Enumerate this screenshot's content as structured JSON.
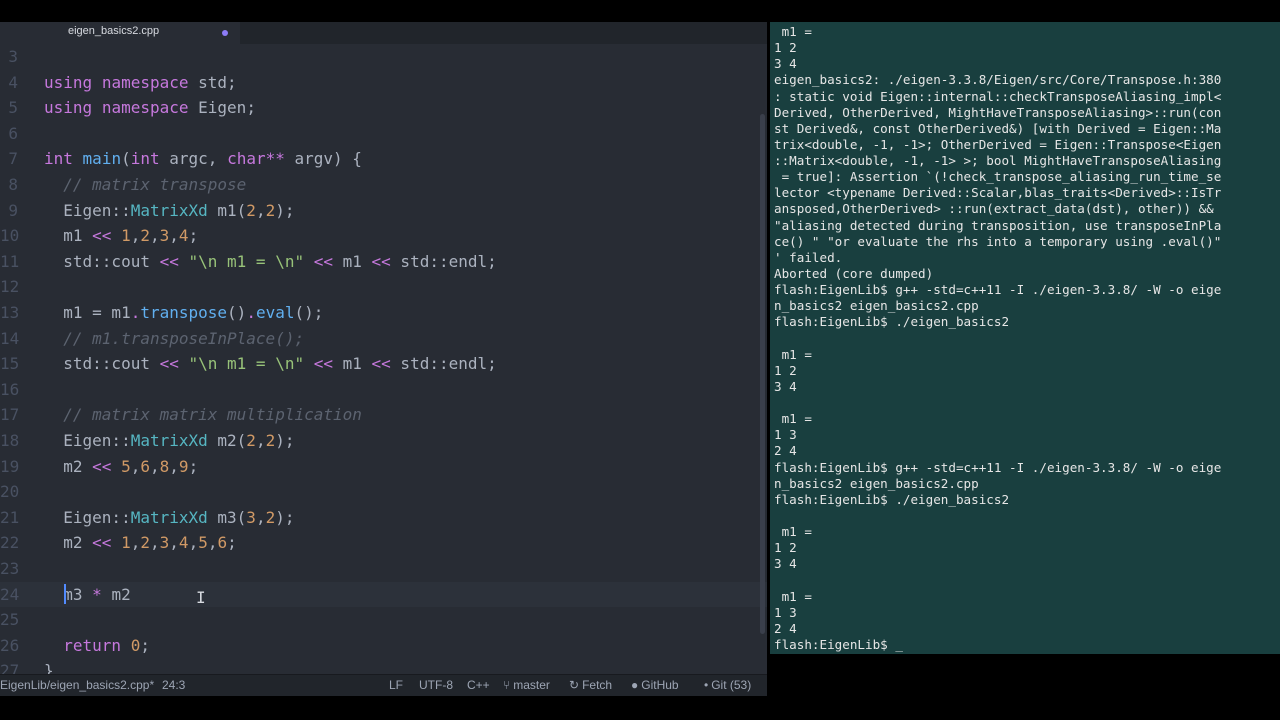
{
  "editor": {
    "tab": {
      "title": "eigen_basics2.cpp"
    },
    "lines": [
      {
        "n": "3",
        "tokens": []
      },
      {
        "n": "4",
        "tokens": [
          [
            "kw",
            "using"
          ],
          [
            "t",
            " "
          ],
          [
            "kw",
            "namespace"
          ],
          [
            "t",
            " std;"
          ]
        ]
      },
      {
        "n": "5",
        "tokens": [
          [
            "kw",
            "using"
          ],
          [
            "t",
            " "
          ],
          [
            "kw",
            "namespace"
          ],
          [
            "t",
            " Eigen;"
          ]
        ]
      },
      {
        "n": "6",
        "tokens": []
      },
      {
        "n": "7",
        "tokens": [
          [
            "kw",
            "int"
          ],
          [
            "t",
            " "
          ],
          [
            "fn",
            "main"
          ],
          [
            "t",
            "("
          ],
          [
            "kw",
            "int"
          ],
          [
            "t",
            " argc, "
          ],
          [
            "kw",
            "char"
          ],
          [
            "op",
            "**"
          ],
          [
            "t",
            " argv) {"
          ]
        ]
      },
      {
        "n": "8",
        "tokens": [
          [
            "t",
            "  "
          ],
          [
            "cm",
            "// matrix transpose"
          ]
        ]
      },
      {
        "n": "9",
        "tokens": [
          [
            "t",
            "  Eigen::"
          ],
          [
            "ty",
            "MatrixXd"
          ],
          [
            "t",
            " m1("
          ],
          [
            "num",
            "2"
          ],
          [
            "t",
            ","
          ],
          [
            "num",
            "2"
          ],
          [
            "t",
            ");"
          ]
        ]
      },
      {
        "n": "10",
        "tokens": [
          [
            "t",
            "  m1 "
          ],
          [
            "op",
            "<<"
          ],
          [
            "t",
            " "
          ],
          [
            "num",
            "1"
          ],
          [
            "t",
            ","
          ],
          [
            "num",
            "2"
          ],
          [
            "t",
            ","
          ],
          [
            "num",
            "3"
          ],
          [
            "t",
            ","
          ],
          [
            "num",
            "4"
          ],
          [
            "t",
            ";"
          ]
        ]
      },
      {
        "n": "11",
        "tokens": [
          [
            "t",
            "  std::cout "
          ],
          [
            "op",
            "<<"
          ],
          [
            "t",
            " "
          ],
          [
            "str",
            "\"\\n m1 = \\n\""
          ],
          [
            "t",
            " "
          ],
          [
            "op",
            "<<"
          ],
          [
            "t",
            " m1 "
          ],
          [
            "op",
            "<<"
          ],
          [
            "t",
            " std::endl;"
          ]
        ]
      },
      {
        "n": "12",
        "tokens": []
      },
      {
        "n": "13",
        "tokens": [
          [
            "t",
            "  m1 = m1"
          ],
          [
            "op",
            "."
          ],
          [
            "fn",
            "transpose"
          ],
          [
            "t",
            "()"
          ],
          [
            "op",
            "."
          ],
          [
            "fn",
            "eval"
          ],
          [
            "t",
            "();"
          ]
        ]
      },
      {
        "n": "14",
        "tokens": [
          [
            "t",
            "  "
          ],
          [
            "cm",
            "// m1.transposeInPlace();"
          ]
        ]
      },
      {
        "n": "15",
        "tokens": [
          [
            "t",
            "  std::cout "
          ],
          [
            "op",
            "<<"
          ],
          [
            "t",
            " "
          ],
          [
            "str",
            "\"\\n m1 = \\n\""
          ],
          [
            "t",
            " "
          ],
          [
            "op",
            "<<"
          ],
          [
            "t",
            " m1 "
          ],
          [
            "op",
            "<<"
          ],
          [
            "t",
            " std::endl;"
          ]
        ]
      },
      {
        "n": "16",
        "tokens": []
      },
      {
        "n": "17",
        "tokens": [
          [
            "t",
            "  "
          ],
          [
            "cm",
            "// matrix matrix multiplication"
          ]
        ]
      },
      {
        "n": "18",
        "tokens": [
          [
            "t",
            "  Eigen::"
          ],
          [
            "ty",
            "MatrixXd"
          ],
          [
            "t",
            " m2("
          ],
          [
            "num",
            "2"
          ],
          [
            "t",
            ","
          ],
          [
            "num",
            "2"
          ],
          [
            "t",
            ");"
          ]
        ]
      },
      {
        "n": "19",
        "tokens": [
          [
            "t",
            "  m2 "
          ],
          [
            "op",
            "<<"
          ],
          [
            "t",
            " "
          ],
          [
            "num",
            "5"
          ],
          [
            "t",
            ","
          ],
          [
            "num",
            "6"
          ],
          [
            "t",
            ","
          ],
          [
            "num",
            "8"
          ],
          [
            "t",
            ","
          ],
          [
            "num",
            "9"
          ],
          [
            "t",
            ";"
          ]
        ]
      },
      {
        "n": "20",
        "tokens": []
      },
      {
        "n": "21",
        "tokens": [
          [
            "t",
            "  Eigen::"
          ],
          [
            "ty",
            "MatrixXd"
          ],
          [
            "t",
            " m3("
          ],
          [
            "num",
            "3"
          ],
          [
            "t",
            ","
          ],
          [
            "num",
            "2"
          ],
          [
            "t",
            ");"
          ]
        ]
      },
      {
        "n": "22",
        "tokens": [
          [
            "t",
            "  m2 "
          ],
          [
            "op",
            "<<"
          ],
          [
            "t",
            " "
          ],
          [
            "num",
            "1"
          ],
          [
            "t",
            ","
          ],
          [
            "num",
            "2"
          ],
          [
            "t",
            ","
          ],
          [
            "num",
            "3"
          ],
          [
            "t",
            ","
          ],
          [
            "num",
            "4"
          ],
          [
            "t",
            ","
          ],
          [
            "num",
            "5"
          ],
          [
            "t",
            ","
          ],
          [
            "num",
            "6"
          ],
          [
            "t",
            ";"
          ]
        ]
      },
      {
        "n": "23",
        "tokens": []
      },
      {
        "n": "24",
        "tokens": [
          [
            "t",
            "  m3 "
          ],
          [
            "op",
            "*"
          ],
          [
            "t",
            " m2"
          ]
        ],
        "cursor": true
      },
      {
        "n": "25",
        "tokens": []
      },
      {
        "n": "26",
        "tokens": [
          [
            "t",
            "  "
          ],
          [
            "kw",
            "return"
          ],
          [
            "t",
            " "
          ],
          [
            "num",
            "0"
          ],
          [
            "t",
            ";"
          ]
        ]
      },
      {
        "n": "27",
        "tokens": [
          [
            "t",
            "}"
          ]
        ]
      }
    ]
  },
  "status": {
    "path": "EigenLib/eigen_basics2.cpp*",
    "position": "24:3",
    "line_ending": "LF",
    "encoding": "UTF-8",
    "grammar": "C++",
    "branch": "master",
    "fetch": "Fetch",
    "github": "GitHub",
    "git": "Git (53)"
  },
  "terminal": {
    "lines": [
      " m1 =",
      "1 2",
      "3 4",
      "eigen_basics2: ./eigen-3.3.8/Eigen/src/Core/Transpose.h:380",
      ": static void Eigen::internal::checkTransposeAliasing_impl<",
      "Derived, OtherDerived, MightHaveTransposeAliasing>::run(con",
      "st Derived&, const OtherDerived&) [with Derived = Eigen::Ma",
      "trix<double, -1, -1>; OtherDerived = Eigen::Transpose<Eigen",
      "::Matrix<double, -1, -1> >; bool MightHaveTransposeAliasing",
      " = true]: Assertion `(!check_transpose_aliasing_run_time_se",
      "lector <typename Derived::Scalar,blas_traits<Derived>::IsTr",
      "ansposed,OtherDerived> ::run(extract_data(dst), other)) &&",
      "\"aliasing detected during transposition, use transposeInPla",
      "ce() \" \"or evaluate the rhs into a temporary using .eval()\"",
      "' failed.",
      "Aborted (core dumped)",
      "flash:EigenLib$ g++ -std=c++11 -I ./eigen-3.3.8/ -W -o eige",
      "n_basics2 eigen_basics2.cpp",
      "flash:EigenLib$ ./eigen_basics2",
      "",
      " m1 =",
      "1 2",
      "3 4",
      "",
      " m1 =",
      "1 3",
      "2 4",
      "flash:EigenLib$ g++ -std=c++11 -I ./eigen-3.3.8/ -W -o eige",
      "n_basics2 eigen_basics2.cpp",
      "flash:EigenLib$ ./eigen_basics2",
      "",
      " m1 =",
      "1 2",
      "3 4",
      "",
      " m1 =",
      "1 3",
      "2 4",
      "flash:EigenLib$ _"
    ]
  }
}
